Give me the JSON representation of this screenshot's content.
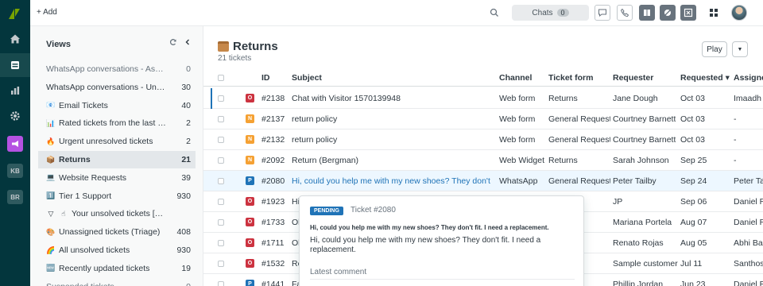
{
  "topbar": {
    "add_label": "+ Add",
    "chats_label": "Chats",
    "chats_count": "0"
  },
  "rail": {
    "badges": [
      "KB",
      "BR"
    ]
  },
  "views": {
    "title": "Views",
    "items": [
      {
        "icon": "",
        "label": "WhatsApp conversations - Assig...",
        "count": "0",
        "muted": true
      },
      {
        "icon": "",
        "label": "WhatsApp conversations - Unass...",
        "count": "30",
        "muted": false
      },
      {
        "icon": "📧",
        "label": "Email Tickets",
        "count": "40",
        "muted": false
      },
      {
        "icon": "📊",
        "label": "Rated tickets from the last 7 d...",
        "count": "2",
        "muted": false
      },
      {
        "icon": "🔥",
        "label": "Urgent unresolved tickets",
        "count": "2",
        "muted": false
      },
      {
        "icon": "📦",
        "label": "Returns",
        "count": "21",
        "muted": false,
        "selected": true
      },
      {
        "icon": "💻",
        "label": "Website Requests",
        "count": "39",
        "muted": false
      },
      {
        "icon": "1️⃣",
        "label": "Tier 1 Support",
        "count": "930",
        "muted": false
      },
      {
        "icon": "☝",
        "label": "Your unsolved tickets [Skil...",
        "count": "",
        "muted": false
      },
      {
        "icon": "🎨",
        "label": "Unassigned tickets (Triage)",
        "count": "408",
        "muted": false
      },
      {
        "icon": "🌈",
        "label": "All unsolved tickets",
        "count": "930",
        "muted": false
      },
      {
        "icon": "🆕",
        "label": "Recently updated tickets",
        "count": "19",
        "muted": false
      },
      {
        "icon": "",
        "label": "Suspended tickets",
        "count": "0",
        "muted": true
      }
    ]
  },
  "main": {
    "title": "Returns",
    "subtitle": "21 tickets",
    "play_label": "Play",
    "columns": [
      "ID",
      "Subject",
      "Channel",
      "Ticket form",
      "Requester",
      "Requested ▾",
      "Assignee"
    ],
    "rows": [
      {
        "status": "O",
        "status_color": "#cc3340",
        "id": "#2138",
        "subject": "Chat with Visitor 1570139948",
        "channel": "Web form",
        "form": "Returns",
        "requester": "Jane Dough",
        "requested": "Oct 03",
        "assignee": "Imaadh S"
      },
      {
        "status": "N",
        "status_color": "#f5a133",
        "id": "#2137",
        "subject": "return policy",
        "channel": "Web form",
        "form": "General Request",
        "requester": "Courtney Barnett",
        "requested": "Oct 03",
        "assignee": "-"
      },
      {
        "status": "N",
        "status_color": "#f5a133",
        "id": "#2132",
        "subject": "return policy",
        "channel": "Web form",
        "form": "General Request",
        "requester": "Courtney Barnett",
        "requested": "Oct 03",
        "assignee": "-"
      },
      {
        "status": "N",
        "status_color": "#f5a133",
        "id": "#2092",
        "subject": "Return (Bergman)",
        "channel": "Web Widget",
        "form": "Returns",
        "requester": "Sarah Johnson",
        "requested": "Sep 25",
        "assignee": "-"
      },
      {
        "status": "P",
        "status_color": "#1f73b7",
        "id": "#2080",
        "subject": "Hi, could you help me with my new shoes? They don't fit....",
        "channel": "WhatsApp",
        "form": "General Request",
        "requester": "Peter Tailby",
        "requested": "Sep 24",
        "assignee": "Peter Tai"
      },
      {
        "status": "O",
        "status_color": "#cc3340",
        "id": "#1923",
        "subject": "Hi",
        "channel": "",
        "form": "uest",
        "requester": "JP",
        "requested": "Sep 06",
        "assignee": "Daniel Ru"
      },
      {
        "status": "O",
        "status_color": "#cc3340",
        "id": "#1733",
        "subject": "Ol",
        "channel": "",
        "form": "atus",
        "requester": "Mariana Portela",
        "requested": "Aug 07",
        "assignee": "Daniel Ru"
      },
      {
        "status": "O",
        "status_color": "#cc3340",
        "id": "#1711",
        "subject": "Ol",
        "channel": "",
        "form": "",
        "requester": "Renato Rojas",
        "requested": "Aug 05",
        "assignee": "Abhi Bas"
      },
      {
        "status": "O",
        "status_color": "#cc3340",
        "id": "#1532",
        "subject": "Re",
        "channel": "",
        "form": "",
        "requester": "Sample customer",
        "requested": "Jul 11",
        "assignee": "Santhosh"
      },
      {
        "status": "P",
        "status_color": "#1f73b7",
        "id": "#1441",
        "subject": "Fa",
        "channel": "",
        "form": "uest",
        "requester": "Phillip Jordan",
        "requested": "Jun 23",
        "assignee": "Daniel Ru"
      }
    ]
  },
  "card": {
    "badge": "PENDING",
    "ticket": "Ticket #2080",
    "bold": "Hi, could you help me with my new shoes? They don't fit. I need a replacement.",
    "body": "Hi, could you help me with my new shoes? They don't fit. I need a replacement.",
    "latest": "Latest comment"
  }
}
